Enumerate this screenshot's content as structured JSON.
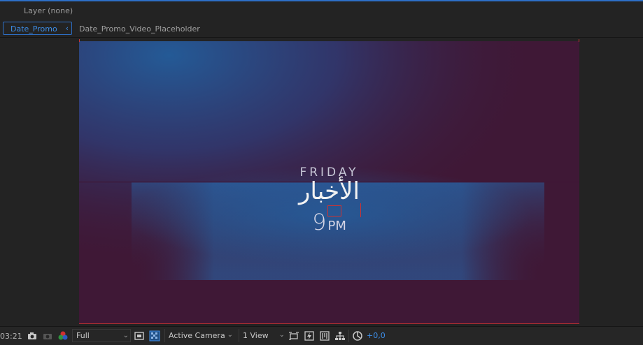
{
  "panel": {
    "layer_label": "Layer (none)"
  },
  "tabs": {
    "active_label": "Date_Promo",
    "active_chevron": "‹",
    "other_label": "Date_Promo_Video_Placeholder"
  },
  "composition": {
    "day": "FRIDAY",
    "arabic_title": "الأخبار",
    "time_number": "9",
    "time_ampm": "PM",
    "colors": {
      "bg_magenta": "#3f1836",
      "bg_blue": "#2a5a96",
      "band_blue": "#2e64a6"
    }
  },
  "toolbar": {
    "timecode": "03:21",
    "snapshot_icon": "camera-icon",
    "show_snapshot_icon": "snapshot-show-icon",
    "channel_icon": "rgb-channel-icon",
    "resolution": "Full",
    "region_icon": "region-of-interest-icon",
    "transparency_icon": "transparency-grid-icon",
    "camera_view": "Active Camera",
    "view_layout": "1 View",
    "toggle_pixel_icon": "pixel-aspect-icon",
    "fast_preview_icon": "fast-preview-icon",
    "timeline_icon": "timeline-icon",
    "flowchart_icon": "flowchart-icon",
    "reset_exposure_icon": "reset-exposure-icon",
    "exposure": "+0,0"
  }
}
